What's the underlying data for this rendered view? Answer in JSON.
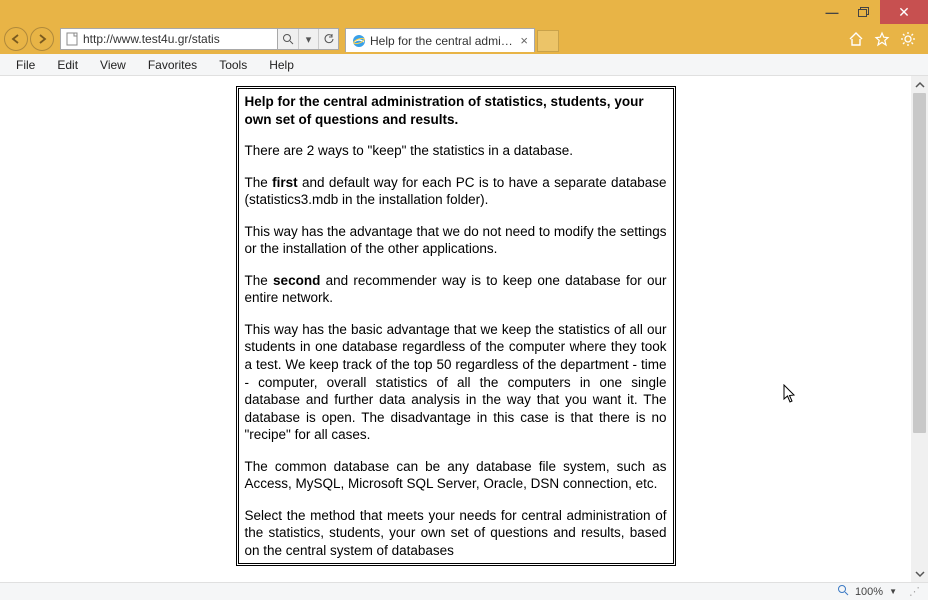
{
  "url": "http://www.test4u.gr/statis",
  "tab_title": "Help for the central admini...",
  "menus": {
    "file": "File",
    "edit": "Edit",
    "view": "View",
    "favorites": "Favorites",
    "tools": "Tools",
    "help": "Help"
  },
  "doc": {
    "heading": "Help for the central administration of statistics, students, your own set of questions and results.",
    "p1": "There are 2 ways to \"keep\" the statistics in a database.",
    "p2a": "The ",
    "p2b": "first",
    "p2c": " and default way for each PC is to have a separate database (statistics3.mdb in the installation folder).",
    "p3": "This way  has the advantage that we do not need to modify the settings or the installation of the other applications.",
    "p4a": "The ",
    "p4b": "second",
    "p4c": " and recommender way is to keep one database for our entire network.",
    "p5": "This way has the basic advantage that we keep the statistics of all our students in one database regardless of the computer where they took a test. We keep track of the top 50 regardless of the department - time - computer, overall statistics of all the computers in one single database and further data analysis in the way that you want it. The database is open. The disadvantage in this case is that there is no \"recipe\" for all cases.",
    "p6": "The common database can be any database file system, such as Access, MySQL, Microsoft SQL Server, Oracle, DSN connection, etc.",
    "p7": "Select the method that meets your needs for central administration of the statistics, students, your own set of questions and results, based on the central system of databases"
  },
  "status": {
    "zoom": "100%"
  }
}
